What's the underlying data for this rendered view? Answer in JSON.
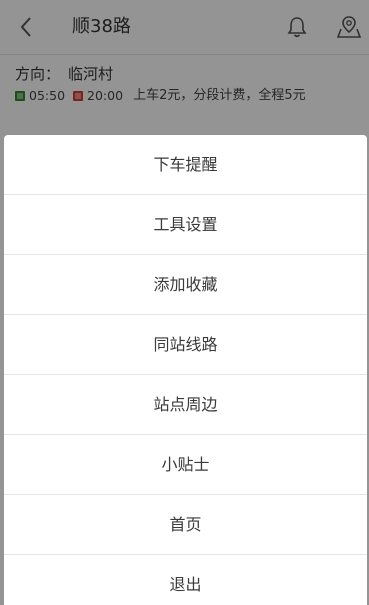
{
  "header": {
    "title": "顺38路",
    "icons": [
      "back-arrow-icon",
      "bell-icon",
      "map-pin-icon"
    ]
  },
  "route": {
    "direction_label": "方向：",
    "direction_value": "临河村",
    "first_time": "05:50",
    "last_time": "20:00",
    "fare": "上车2元，分段计费，全程5元"
  },
  "menu": {
    "items": [
      "下车提醒",
      "工具设置",
      "添加收藏",
      "同站线路",
      "站点周边",
      "小贴士",
      "首页",
      "退出"
    ]
  },
  "colors": {
    "first_badge": "#2e8b2e",
    "last_badge": "#d83a2e",
    "overlay": "rgba(0,0,0,0.42)"
  }
}
